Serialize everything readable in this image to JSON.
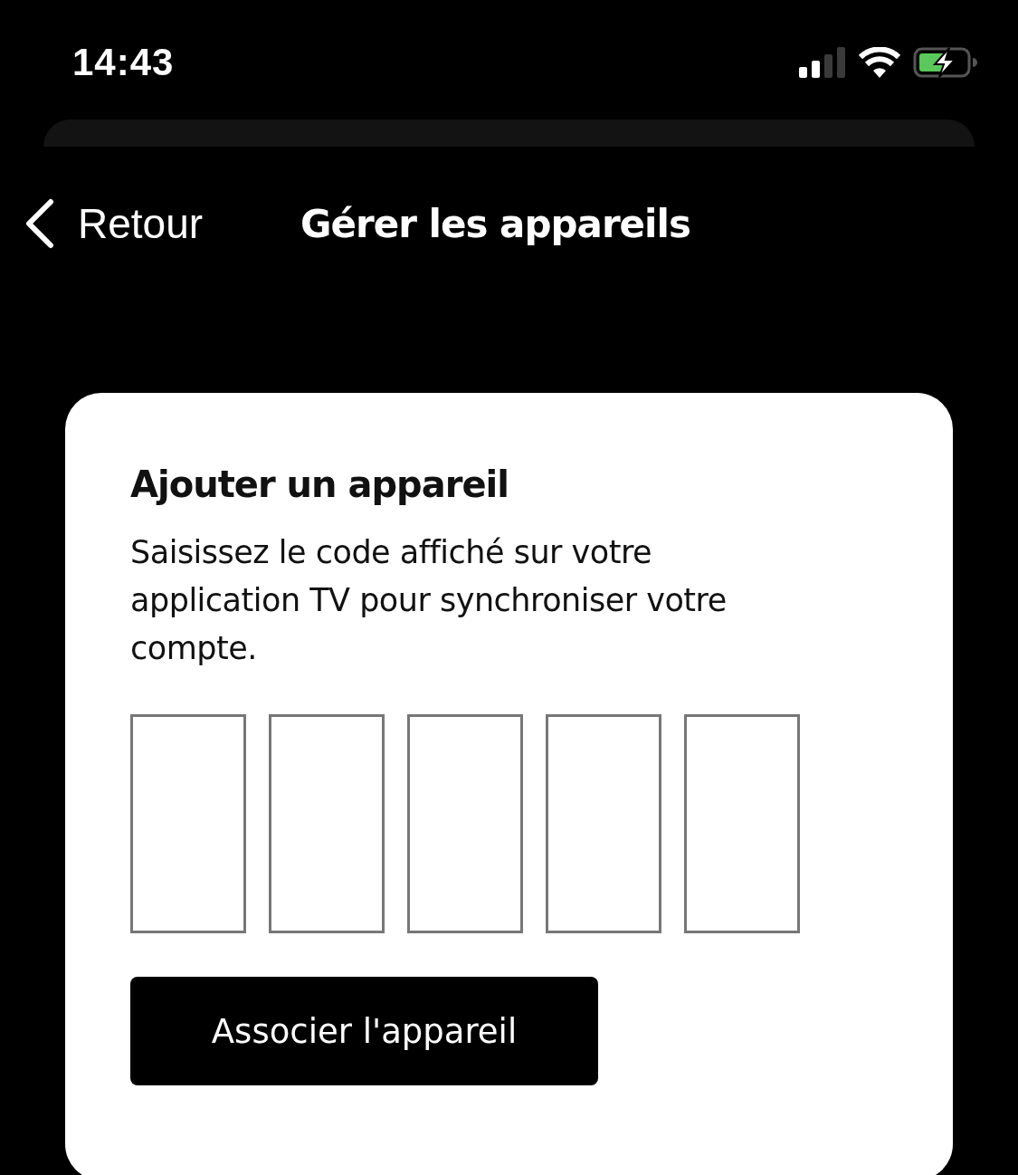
{
  "status_bar": {
    "time": "14:43"
  },
  "nav": {
    "back_label": "Retour",
    "title": "Gérer les appareils"
  },
  "card": {
    "title": "Ajouter un appareil",
    "description": "Saisissez le code affiché sur votre application TV pour synchroniser votre compte.",
    "code_fields": [
      {
        "kind": "digit"
      },
      {
        "kind": "digit"
      },
      {
        "kind": "digit"
      },
      {
        "kind": "digit"
      },
      {
        "kind": "digit"
      }
    ],
    "button": "Associer l'appareil"
  }
}
